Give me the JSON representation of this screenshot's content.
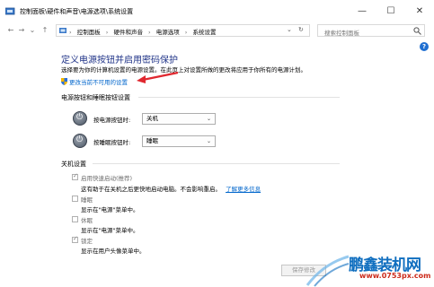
{
  "window": {
    "title": "控制面板\\硬件和声音\\电源选项\\系统设置",
    "min_label": "—",
    "max_label": "☐",
    "close_label": "✕"
  },
  "nav": {
    "back": "←",
    "forward": "→",
    "up": "↑",
    "history": "⌄",
    "refresh": "↻",
    "crumbs": [
      "控制面板",
      "硬件和声音",
      "电源选项",
      "系统设置"
    ],
    "crumb_sep": "›",
    "search_placeholder": "搜索控制面板",
    "search_icon": "search-icon"
  },
  "main": {
    "heading": "定义电源按钮并启用密码保护",
    "description": "选择要为你的计算机设置的电源设置。在此页上对设置所做的更改将应用于你所有的电源计划。",
    "change_settings_link": "更改当前不可用的设置"
  },
  "power_buttons": {
    "section_title": "电源按钮和睡眠按钮设置",
    "power_label": "按电源按钮时:",
    "power_value": "关机",
    "sleep_label": "按睡眠按钮时:",
    "sleep_value": "睡眠"
  },
  "shutdown": {
    "section_title": "关机设置",
    "items": [
      {
        "label": "启用快速启动(推荐)",
        "desc": "这有助于在关机之后更快地启动电脑。不会影响重启。",
        "link": "了解更多信息",
        "checked": true
      },
      {
        "label": "睡眠",
        "desc": "显示在\"电源\"菜单中。",
        "checked": false
      },
      {
        "label": "休眠",
        "desc": "显示在\"电源\"菜单中。",
        "checked": false
      },
      {
        "label": "锁定",
        "desc": "显示在用户头像菜单中。",
        "checked": true
      }
    ]
  },
  "footer": {
    "save_label": "保存修改"
  },
  "watermark": {
    "brand": "鹏鑫装机网",
    "url": "www.0753px.com"
  },
  "colors": {
    "heading": "#1e3287",
    "link": "#0066cc",
    "arrow": "#e0282f",
    "watermark_blue": "#0f6ebf",
    "watermark_red": "#cc2a1a"
  }
}
